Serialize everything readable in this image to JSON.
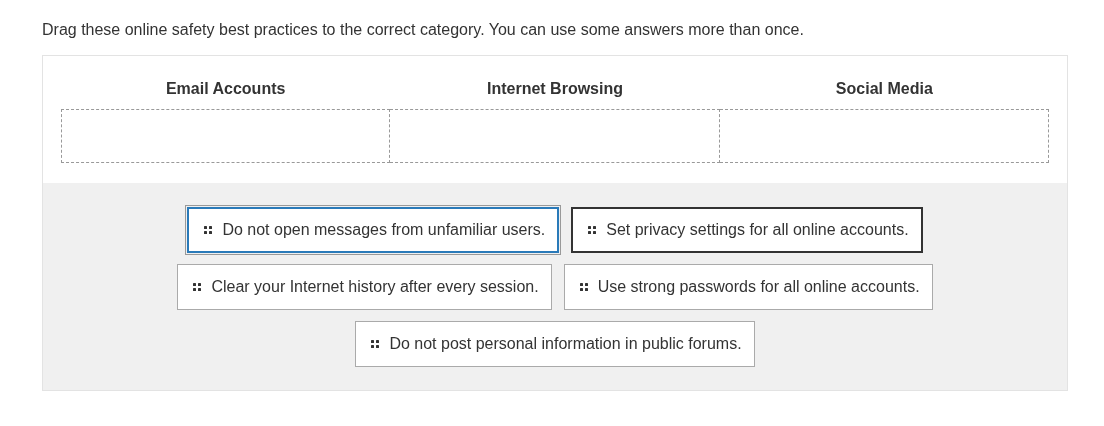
{
  "instruction": "Drag these online safety best practices to the correct category. You can use some answers more than once.",
  "categories": [
    {
      "title": "Email Accounts"
    },
    {
      "title": "Internet Browsing"
    },
    {
      "title": "Social Media"
    }
  ],
  "answer_rows": [
    [
      {
        "label": "Do not open messages from unfamiliar users.",
        "focused": true,
        "hovered": false
      },
      {
        "label": "Set privacy settings for all online accounts.",
        "focused": false,
        "hovered": true
      }
    ],
    [
      {
        "label": "Clear your Internet history after every session.",
        "focused": false,
        "hovered": false
      },
      {
        "label": "Use strong passwords for all online accounts.",
        "focused": false,
        "hovered": false
      }
    ],
    [
      {
        "label": "Do not post personal information in public forums.",
        "focused": false,
        "hovered": false
      }
    ]
  ]
}
